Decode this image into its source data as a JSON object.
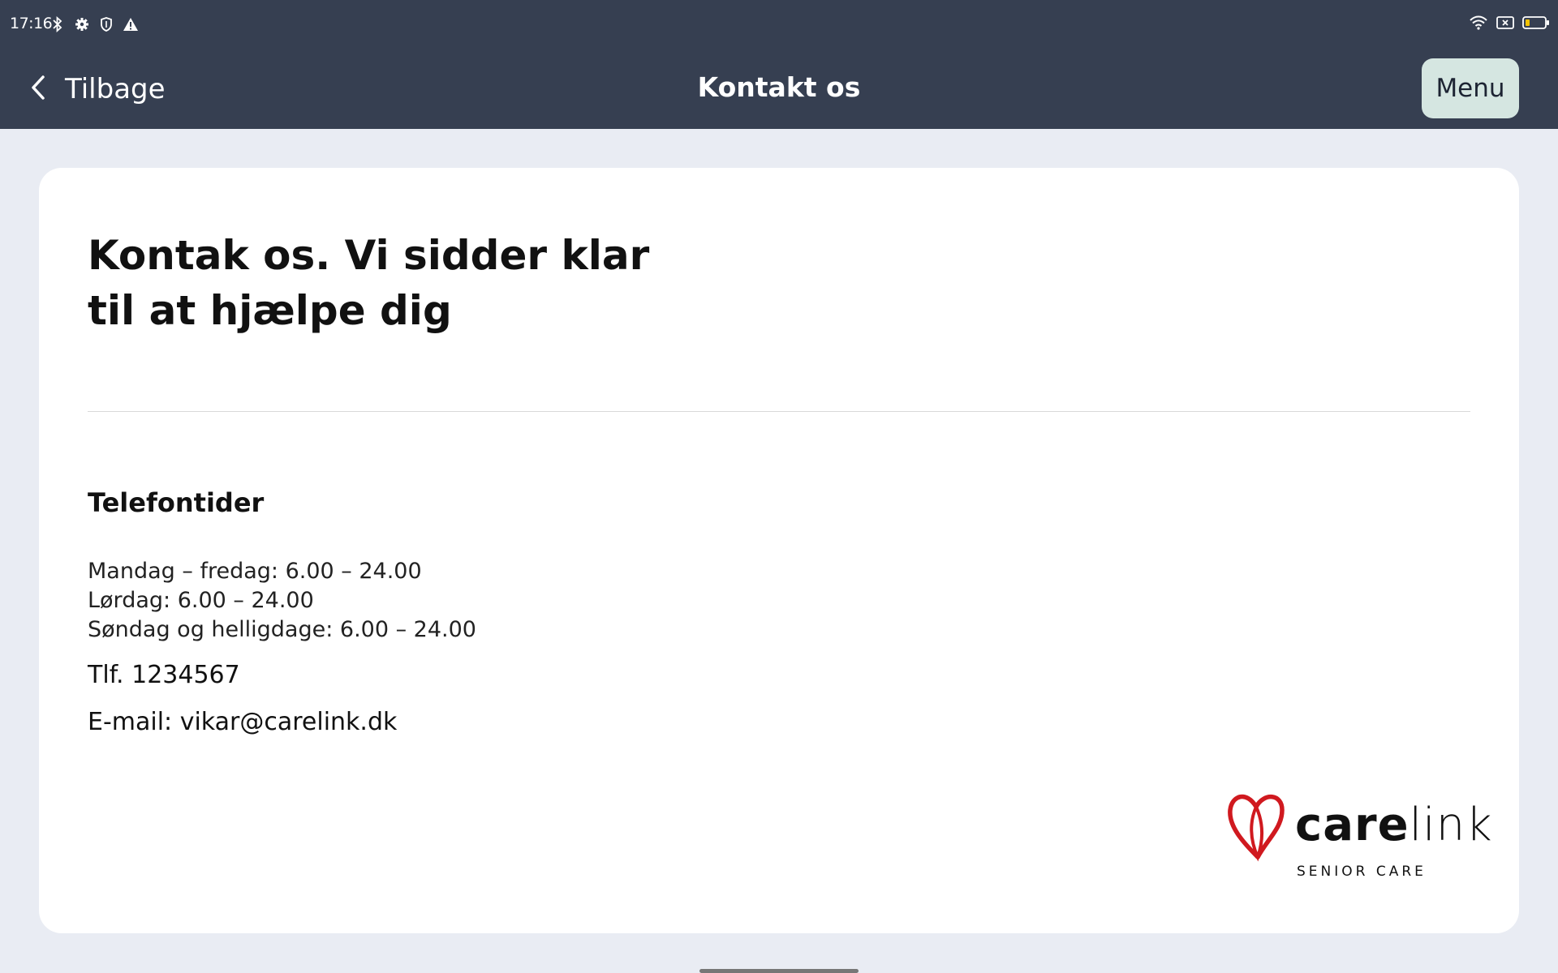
{
  "status_bar": {
    "time": "17:16",
    "left_icons": [
      "bluetooth-icon",
      "settings-gear-icon",
      "shield-icon",
      "warning-icon"
    ],
    "right_icons": [
      "wifi-icon",
      "sim-card-icon",
      "battery-icon"
    ]
  },
  "header": {
    "back_label": "Tilbage",
    "title": "Kontakt os",
    "menu_label": "Menu",
    "background_color": "#363F51",
    "menu_button_color": "#D5E6E1"
  },
  "content": {
    "headline": "Kontak os. Vi sidder klar til at hjælpe dig",
    "section_heading": "Telefontider",
    "hours": [
      "Mandag – fredag: 6.00 – 24.00",
      "Lørdag: 6.00 – 24.00",
      "Søndag og helligdage: 6.00 – 24.00"
    ],
    "phone": "Tlf. 1234567",
    "email": "E-mail: vikar@carelink.dk"
  },
  "logo": {
    "word_bold": "care",
    "word_light": "link",
    "subtitle": "SENIOR CARE",
    "heart_color": "#D0191F"
  }
}
